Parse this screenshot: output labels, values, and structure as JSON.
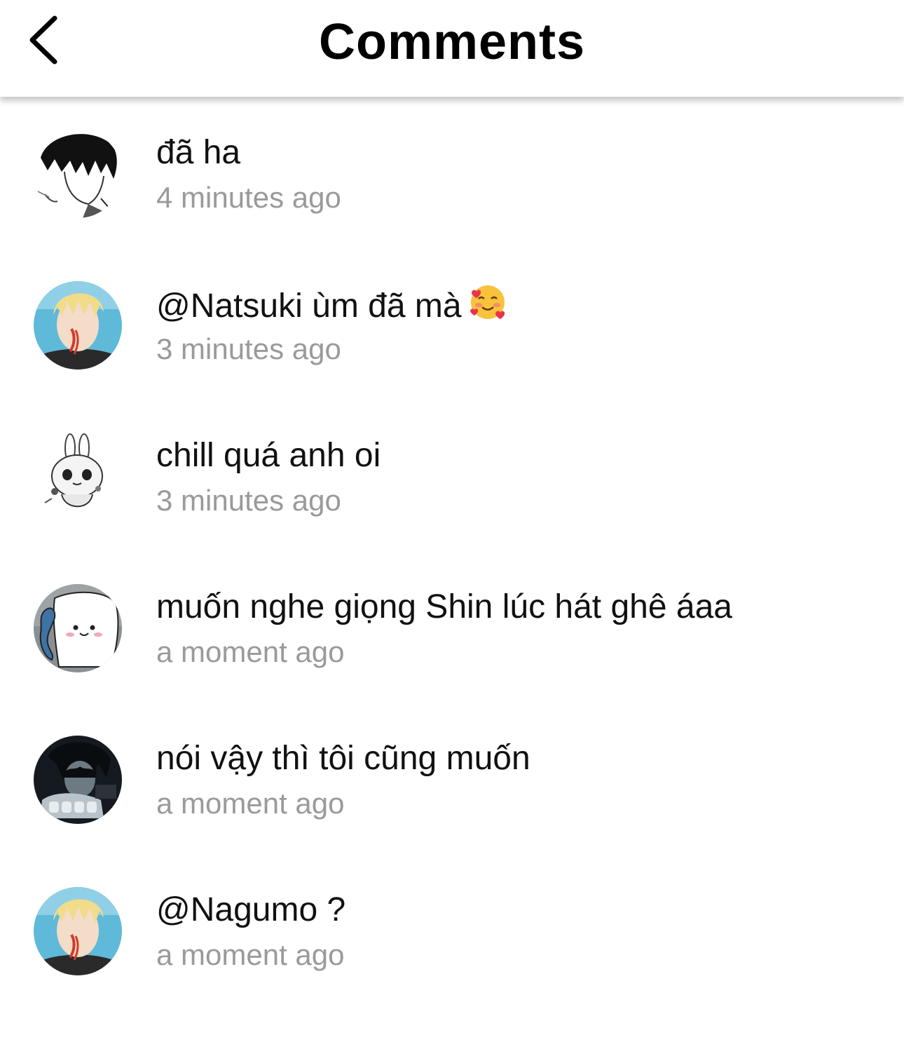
{
  "header": {
    "title": "Comments",
    "back_icon": "chevron-left-icon"
  },
  "comments": [
    {
      "text": "đã ha",
      "time": "4 minutes ago",
      "avatar": "manga-boy-sketch-avatar"
    },
    {
      "text": "@Natsuki ùm đã mà",
      "emoji": "smiling-face-with-hearts-icon",
      "time": "3 minutes ago",
      "avatar": "blonde-anime-avatar"
    },
    {
      "text": "chill quá anh oi",
      "time": "3 minutes ago",
      "avatar": "bunny-sketch-avatar"
    },
    {
      "text": "muốn nghe giọng Shin lúc hát ghê áaa",
      "time": "a moment ago",
      "avatar": "ghost-cartoon-avatar"
    },
    {
      "text": "nói vậy thì tôi cũng muốn",
      "time": "a moment ago",
      "avatar": "dark-anime-avatar"
    },
    {
      "text": "@Nagumo ?",
      "time": "a moment ago",
      "avatar": "blonde-anime-avatar"
    }
  ]
}
